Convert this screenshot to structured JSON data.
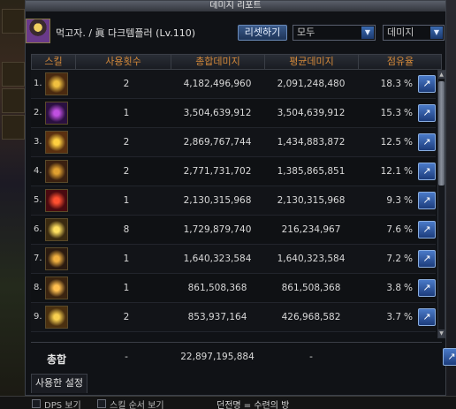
{
  "window": {
    "title": "데미지 리포트"
  },
  "character": {
    "name": "먹고자. / 眞 다크템플러 (Lv.110)"
  },
  "controls": {
    "reset_label": "리셋하기",
    "range_value": "모두",
    "type_value": "데미지"
  },
  "table": {
    "headers": {
      "skill": "스킬",
      "count": "사용횟수",
      "total": "총합데미지",
      "avg": "평균데미지",
      "share": "점유율"
    },
    "rows": [
      {
        "rank": "1.",
        "count": "2",
        "total": "4,182,496,960",
        "avg": "2,091,248,480",
        "share": "18.3",
        "color_a": "#f0c040",
        "color_b": "#4a2a10"
      },
      {
        "rank": "2.",
        "count": "1",
        "total": "3,504,639,912",
        "avg": "3,504,639,912",
        "share": "15.3",
        "color_a": "#c050e0",
        "color_b": "#2a1040"
      },
      {
        "rank": "3.",
        "count": "2",
        "total": "2,869,767,744",
        "avg": "1,434,883,872",
        "share": "12.5",
        "color_a": "#ffd040",
        "color_b": "#5a3010"
      },
      {
        "rank": "4.",
        "count": "2",
        "total": "2,771,731,702",
        "avg": "1,385,865,851",
        "share": "12.1",
        "color_a": "#e0a030",
        "color_b": "#3a2010"
      },
      {
        "rank": "5.",
        "count": "1",
        "total": "2,130,315,968",
        "avg": "2,130,315,968",
        "share": "9.3",
        "color_a": "#ff5030",
        "color_b": "#4a0a10"
      },
      {
        "rank": "6.",
        "count": "8",
        "total": "1,729,879,740",
        "avg": "216,234,967",
        "share": "7.6",
        "color_a": "#ffe060",
        "color_b": "#3a2a10"
      },
      {
        "rank": "7.",
        "count": "1",
        "total": "1,640,323,584",
        "avg": "1,640,323,584",
        "share": "7.2",
        "color_a": "#f0b040",
        "color_b": "#2a1a10"
      },
      {
        "rank": "8.",
        "count": "1",
        "total": "861,508,368",
        "avg": "861,508,368",
        "share": "3.8",
        "color_a": "#ffc050",
        "color_b": "#3a2410"
      },
      {
        "rank": "9.",
        "count": "2",
        "total": "853,937,164",
        "avg": "426,968,582",
        "share": "3.7",
        "color_a": "#f8d050",
        "color_b": "#4a3010"
      }
    ],
    "percent_sign": "%",
    "share_icon": "↗"
  },
  "totals": {
    "label": "총합",
    "count": "-",
    "total": "22,897,195,884",
    "avg": "-"
  },
  "tabs": {
    "settings": "사용한 설정"
  },
  "bottom": {
    "dps_label": "DPS 보기",
    "order_label": "스킬 순서 보기",
    "dungeon": "던전명 = 수련의 방"
  }
}
